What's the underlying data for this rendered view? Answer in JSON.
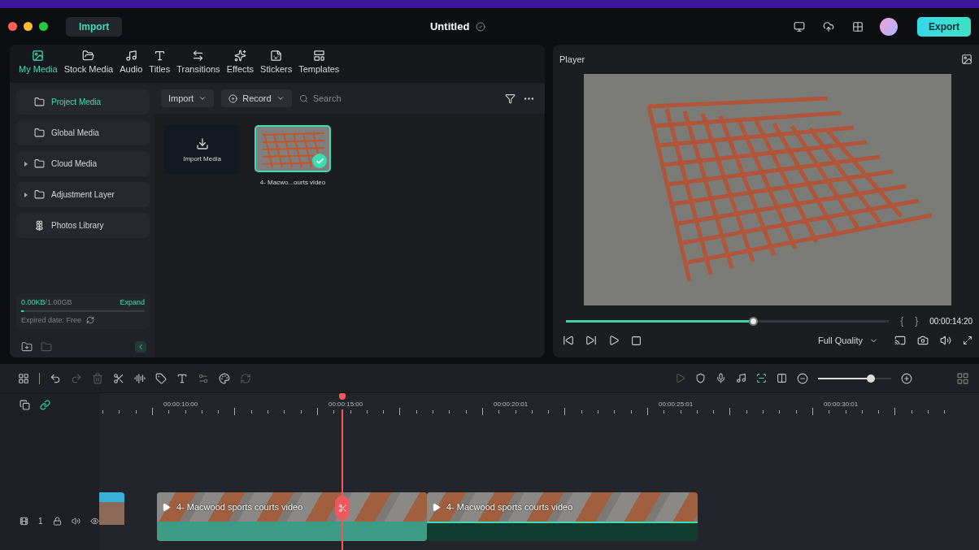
{
  "titlebar": {
    "import_button": "Import",
    "title": "Untitled",
    "export_button": "Export"
  },
  "media_tabs": [
    {
      "label": "My Media",
      "selected": true
    },
    {
      "label": "Stock Media",
      "selected": false
    },
    {
      "label": "Audio",
      "selected": false
    },
    {
      "label": "Titles",
      "selected": false
    },
    {
      "label": "Transitions",
      "selected": false
    },
    {
      "label": "Effects",
      "selected": false
    },
    {
      "label": "Stickers",
      "selected": false
    },
    {
      "label": "Templates",
      "selected": false
    }
  ],
  "sidebar": {
    "items": [
      {
        "label": "Project Media",
        "selected": true,
        "expandable": false,
        "kind": "folder"
      },
      {
        "label": "Global Media",
        "selected": false,
        "expandable": false,
        "kind": "folder"
      },
      {
        "label": "Cloud Media",
        "selected": false,
        "expandable": true,
        "kind": "folder"
      },
      {
        "label": "Adjustment Layer",
        "selected": false,
        "expandable": true,
        "kind": "folder"
      },
      {
        "label": "Photos Library",
        "selected": false,
        "expandable": false,
        "kind": "photos"
      }
    ],
    "storage": {
      "used": "0.00KB",
      "total": "/1.00GB",
      "expand": "Expand",
      "expired": "Expired date: Free",
      "level": 0.02
    }
  },
  "media_toolbar": {
    "import": "Import",
    "record": "Record",
    "search_placeholder": "Search"
  },
  "media_items": [
    {
      "kind": "import",
      "label": "Import Media"
    },
    {
      "kind": "clip",
      "label": "4- Macwo...ourts video",
      "selected": true
    }
  ],
  "player": {
    "title": "Player",
    "level": 0.58,
    "mark_in": "{",
    "mark_out": "}",
    "timecode": "00:00:14:20",
    "quality": "Full Quality"
  },
  "timeline": {
    "zoom": {
      "level": 0.72
    },
    "ruler": [
      "00:00:10:00",
      "00:00:15:00",
      "00:00:20:01",
      "00:00:25:01",
      "00:00:30:01"
    ],
    "track_label": "1",
    "clips": [
      {
        "label": "4- Macwood sports courts video",
        "selected": true
      },
      {
        "label": "4- Macwood sports courts video",
        "selected": false
      }
    ]
  }
}
